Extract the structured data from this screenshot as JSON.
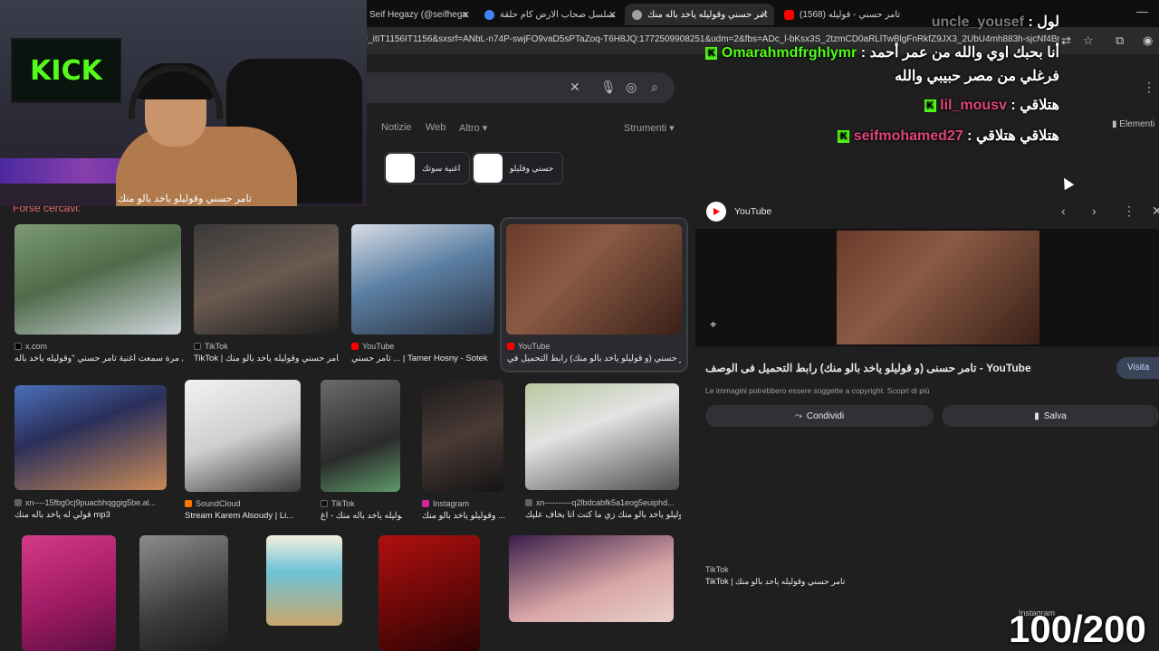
{
  "tabs": [
    {
      "label": "Seif Hegazy (@seifhegazy",
      "color": "#1da1f2"
    },
    {
      "label": "مسلسل صحاب الارض كام حلقة -",
      "color": "#4285f4"
    },
    {
      "label": "تامر حسني وقوليله ياخد باله منك",
      "color": "#9aa0a6"
    },
    {
      "label": "(1568) تامر حسني - قوليله",
      "color": "#ff0000"
    }
  ],
  "address": {
    "url": "F_itIT1156IT1156&sxsrf=ANbL-n74P-swjFO9vaD5sPTaZoq-T6H8JQ:1772509908251&udm=2&fbs=ADc_l-bKsx3S_2tzmCD0aRLlTwBlgFnRkfZ9JX3_2UbU4mh883h-sjcNf4BmdQC..."
  },
  "search": {
    "filters": [
      "Notizie",
      "Web",
      "Altro",
      "Strumenti"
    ],
    "chips": [
      {
        "label": "اغنية سوتك"
      },
      {
        "label": "حسني وفليلو"
      }
    ],
    "forse_cercavi": "Forse cercavi:"
  },
  "results": [
    {
      "source": "x.com",
      "title": "اول مرة سمعت اغنية تامر حسني \"وقوليله ياخد باله ..."
    },
    {
      "source": "TikTok",
      "title": "TikTok | تامر حسني وقوليله ياخد بالو منك"
    },
    {
      "source": "YouTube",
      "title": "تامر حسني ... | Tamer Hosny - Sotek"
    },
    {
      "source": "YouTube",
      "title": "تامر حسني (و قوليلو ياخد بالو منك) رابط التحميل في ..."
    },
    {
      "source": "xn----15fbg0cj9puacbhqggig5be.al...",
      "title": "قولي له ياخد باله منك mp3"
    },
    {
      "source": "SoundCloud",
      "title": "Stream Karem Alsoudy | Li..."
    },
    {
      "source": "TikTok",
      "title": "وقوليله ياخد باله منك - اغ..."
    },
    {
      "source": "Instagram",
      "title": "وقوليلو ياخد بالو منك ..."
    },
    {
      "source": "xn----------q2lbdcabfk5a1eog5euiphd...",
      "title": "وقوليلو ياخد بالو منك زي ما كنت انا بخاف عليك..."
    }
  ],
  "panel": {
    "name": "YouTube",
    "title": "تامر حسنى (و قوليلو ياخد بالو منك) رابط التحميل فى الوصف - YouTube",
    "visit": "Visita",
    "copyright": "Le immagini potrebbero essere soggette a copyright. Scopri di più",
    "share": "Condividi",
    "save": "Salva",
    "related_source": "TikTok",
    "related_title": "TikTok | تامر حسني وقوليله ياخد بالو منك",
    "instagram": "Instagram",
    "elementi": "Elementi"
  },
  "stream": {
    "kick_logo": "KICK",
    "cam_subtitle": "تامر حسني وقوليلو ياخد بالو منك",
    "counter": "100/200",
    "chat": [
      {
        "user": "uncle_yousef",
        "message": "لول",
        "user_color": "#7a7a7a"
      },
      {
        "user": "Omarahmdfrghlymr",
        "message": "أنا بحبك اوي والله من عمر أحمد",
        "user_color": "#53fc18"
      },
      {
        "user": "",
        "message": "فرغلي من مصر حبيبي والله",
        "user_color": "#53fc18"
      },
      {
        "user": "lil_mousv",
        "message": "هتلاقي",
        "user_color": "#e0457b"
      },
      {
        "user": "seifmohamed27",
        "message": "هتلاقي هتلاقي",
        "user_color": "#e0457b"
      }
    ]
  },
  "colors": {
    "accent_green": "#53fc18",
    "page_bg": "#1f1f1f",
    "youtube_red": "#ff0000"
  }
}
